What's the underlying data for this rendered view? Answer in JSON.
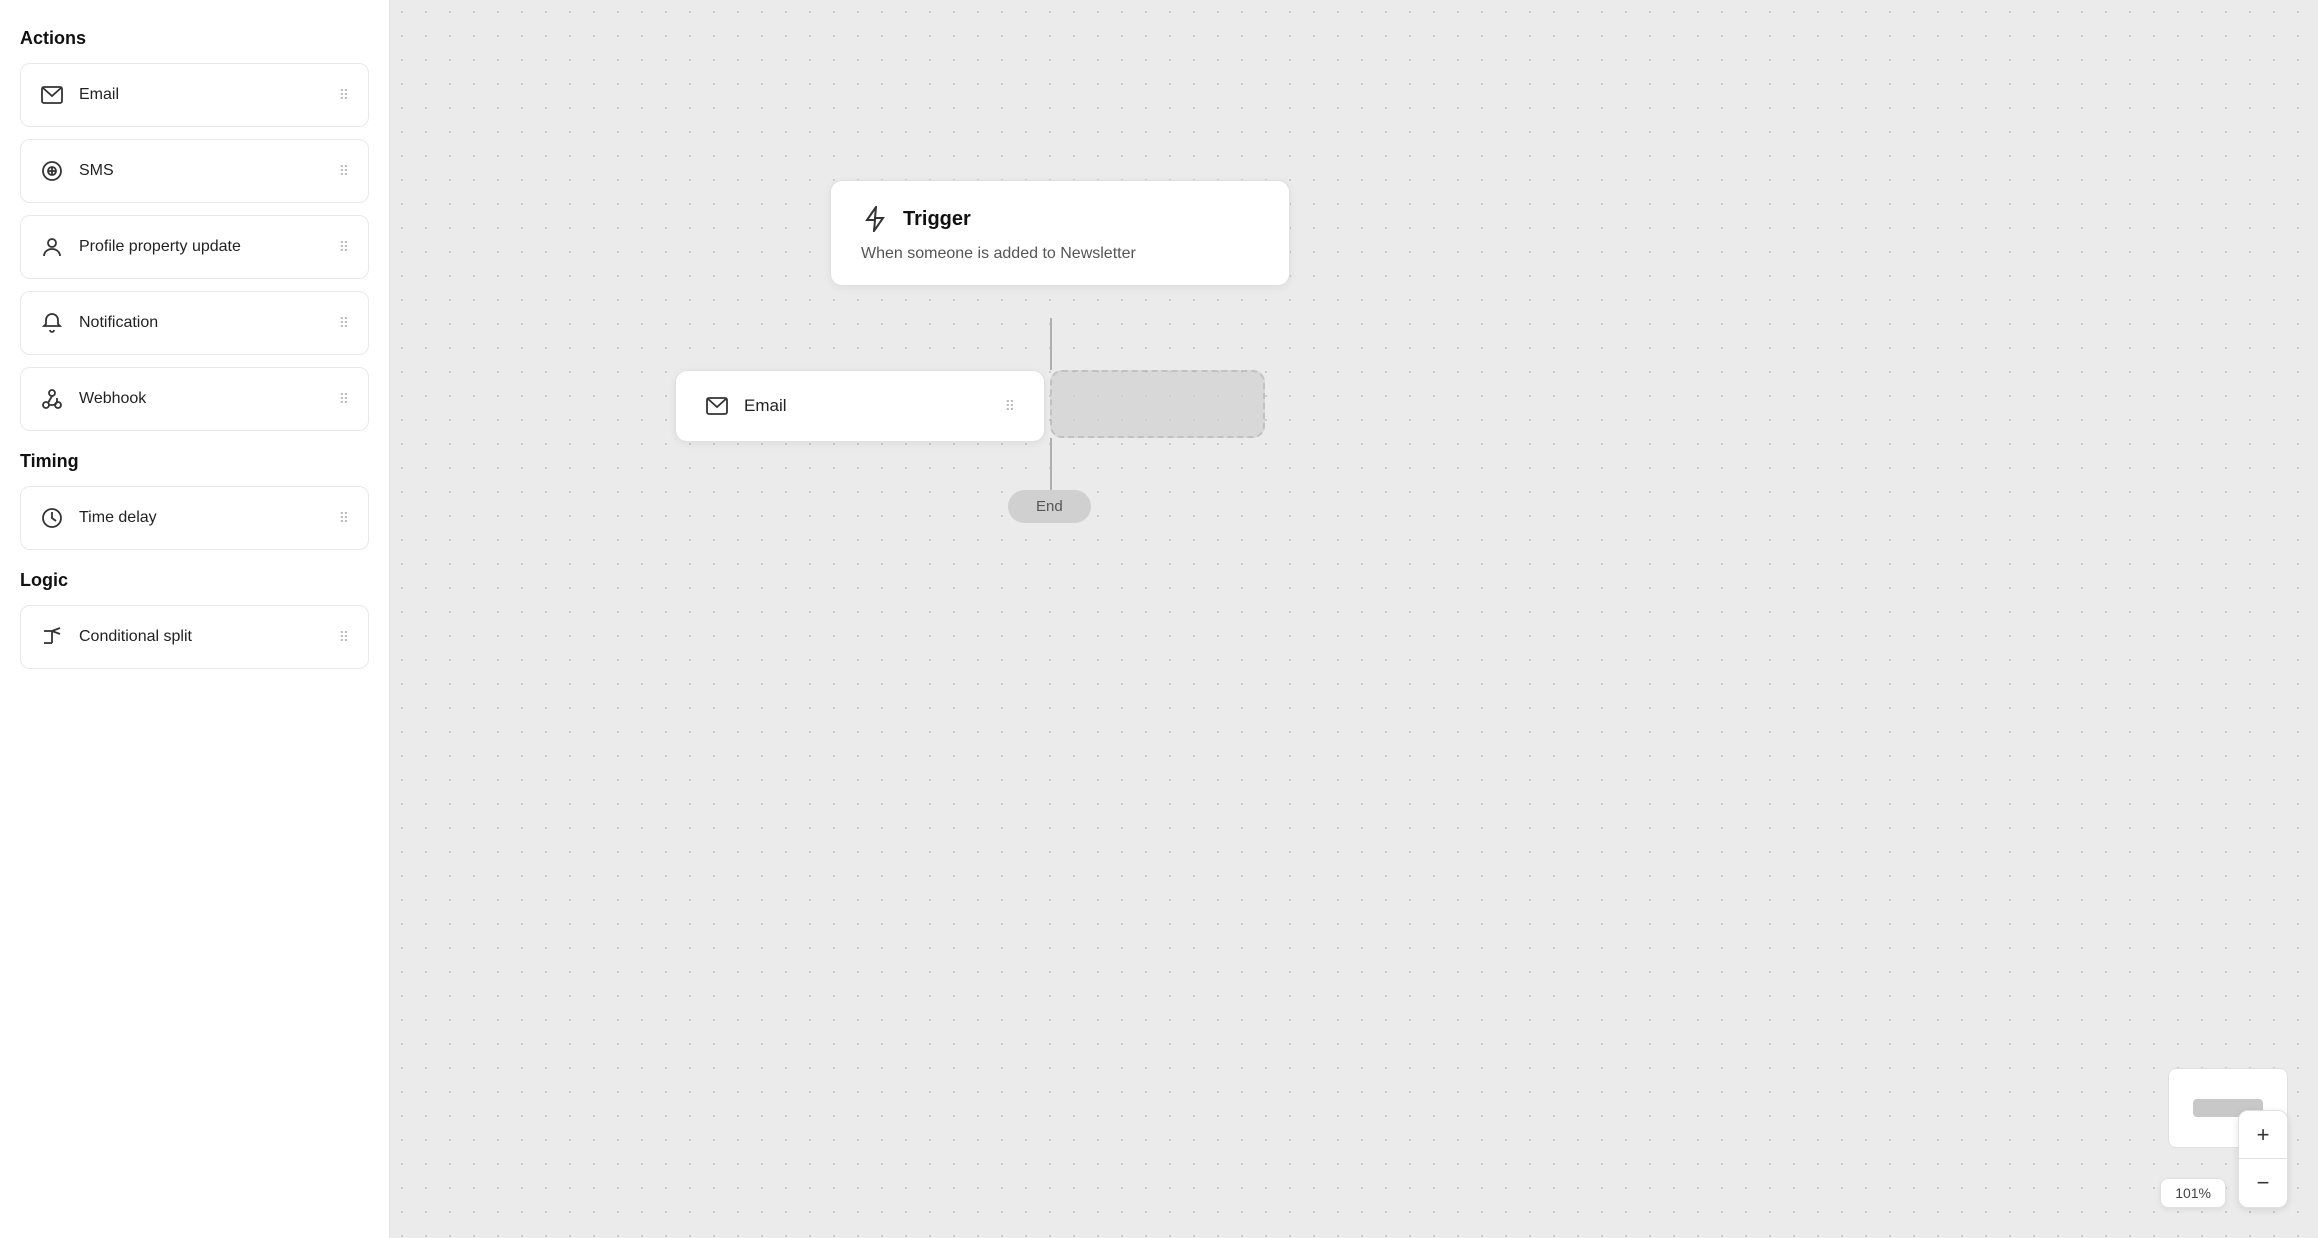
{
  "sidebar": {
    "sections": [
      {
        "id": "actions",
        "title": "Actions",
        "items": [
          {
            "id": "email",
            "label": "Email",
            "icon": "envelope"
          },
          {
            "id": "sms",
            "label": "SMS",
            "icon": "sms"
          },
          {
            "id": "profile-property-update",
            "label": "Profile property update",
            "icon": "person"
          },
          {
            "id": "notification",
            "label": "Notification",
            "icon": "bell"
          },
          {
            "id": "webhook",
            "label": "Webhook",
            "icon": "webhook"
          }
        ]
      },
      {
        "id": "timing",
        "title": "Timing",
        "items": [
          {
            "id": "time-delay",
            "label": "Time delay",
            "icon": "clock"
          }
        ]
      },
      {
        "id": "logic",
        "title": "Logic",
        "items": [
          {
            "id": "conditional-split",
            "label": "Conditional split",
            "icon": "split"
          }
        ]
      }
    ]
  },
  "canvas": {
    "trigger": {
      "title": "Trigger",
      "subtitle": "When someone is added to Newsletter"
    },
    "email_node": {
      "label": "Email"
    },
    "end_node": {
      "label": "End"
    },
    "zoom_level": "101%",
    "zoom_plus_label": "+",
    "zoom_minus_label": "−"
  }
}
